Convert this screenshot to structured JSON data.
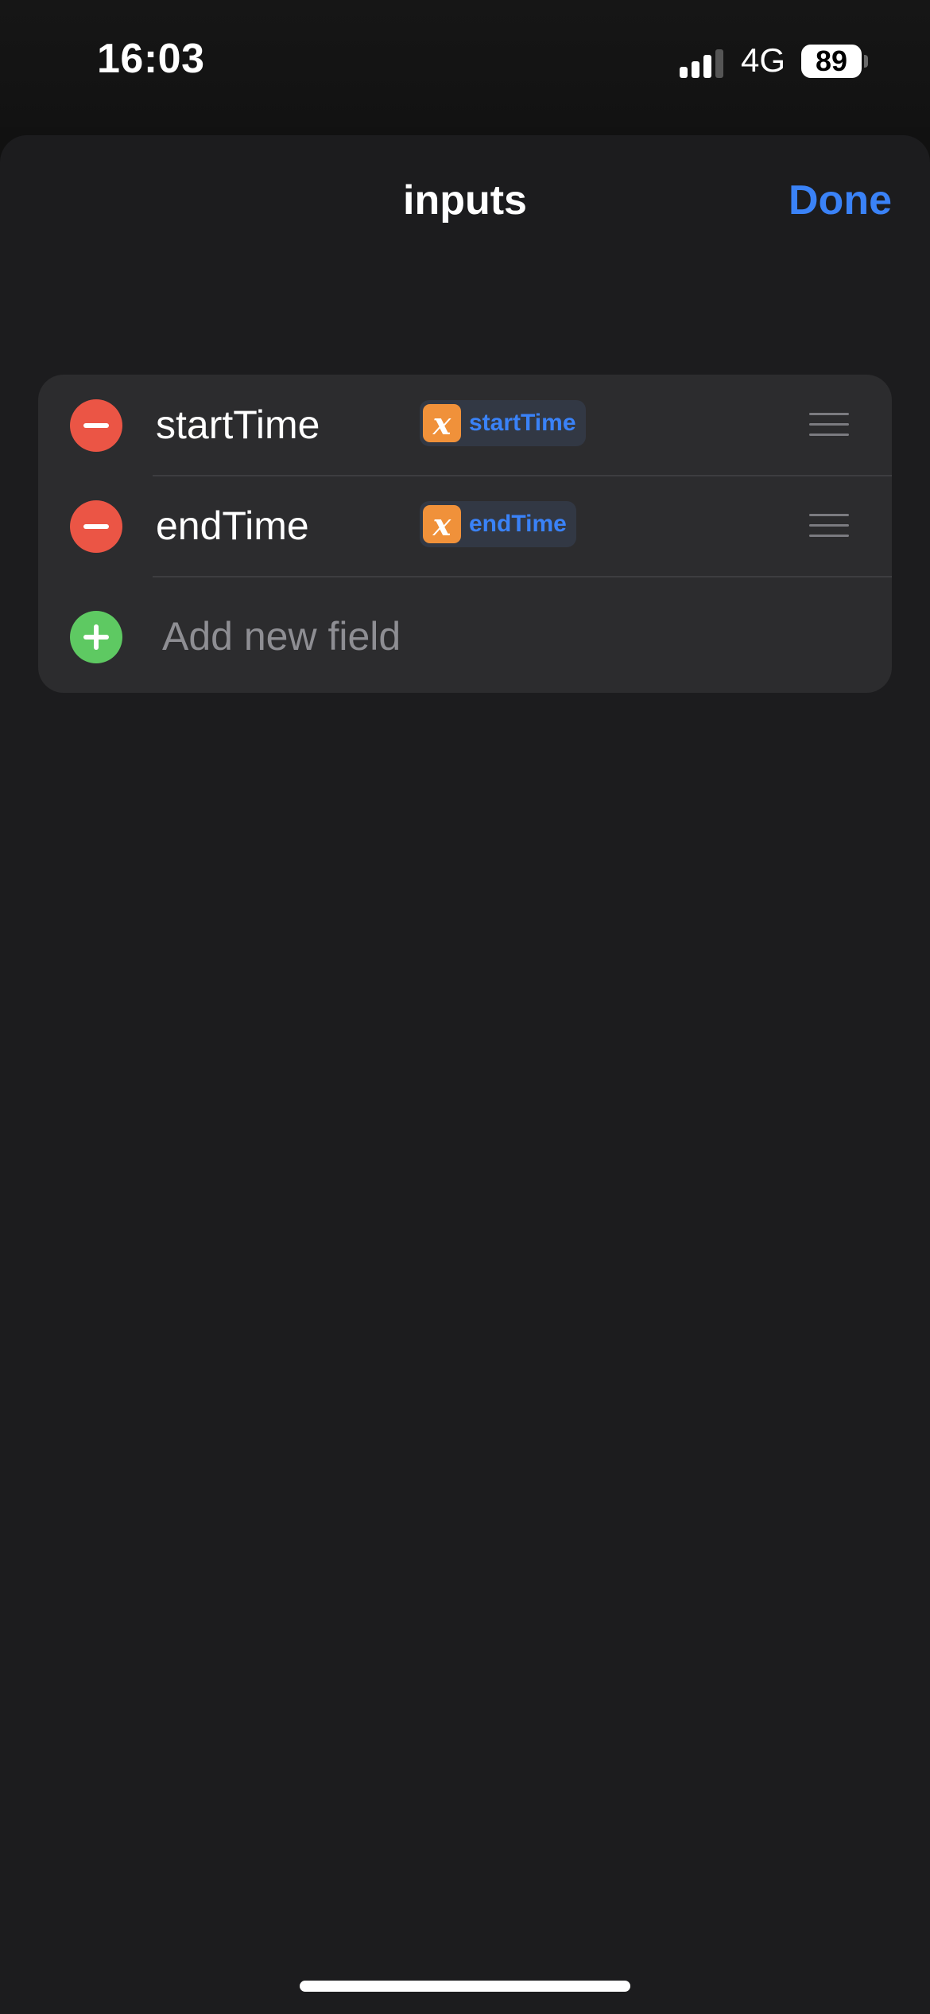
{
  "status_bar": {
    "time": "16:03",
    "network": "4G",
    "battery": "89"
  },
  "sheet": {
    "title": "inputs",
    "done_label": "Done"
  },
  "fields": [
    {
      "name": "startTime",
      "variable_icon": "x",
      "variable": "startTime"
    },
    {
      "name": "endTime",
      "variable_icon": "x",
      "variable": "endTime"
    }
  ],
  "add_field": {
    "placeholder": "Add new field"
  },
  "colors": {
    "accent": "#3a82f7",
    "remove": "#eb5545",
    "add": "#5ec962",
    "variable_icon": "#f0913a",
    "sheet_bg": "#1c1c1e",
    "card_bg": "#2c2c2e"
  }
}
